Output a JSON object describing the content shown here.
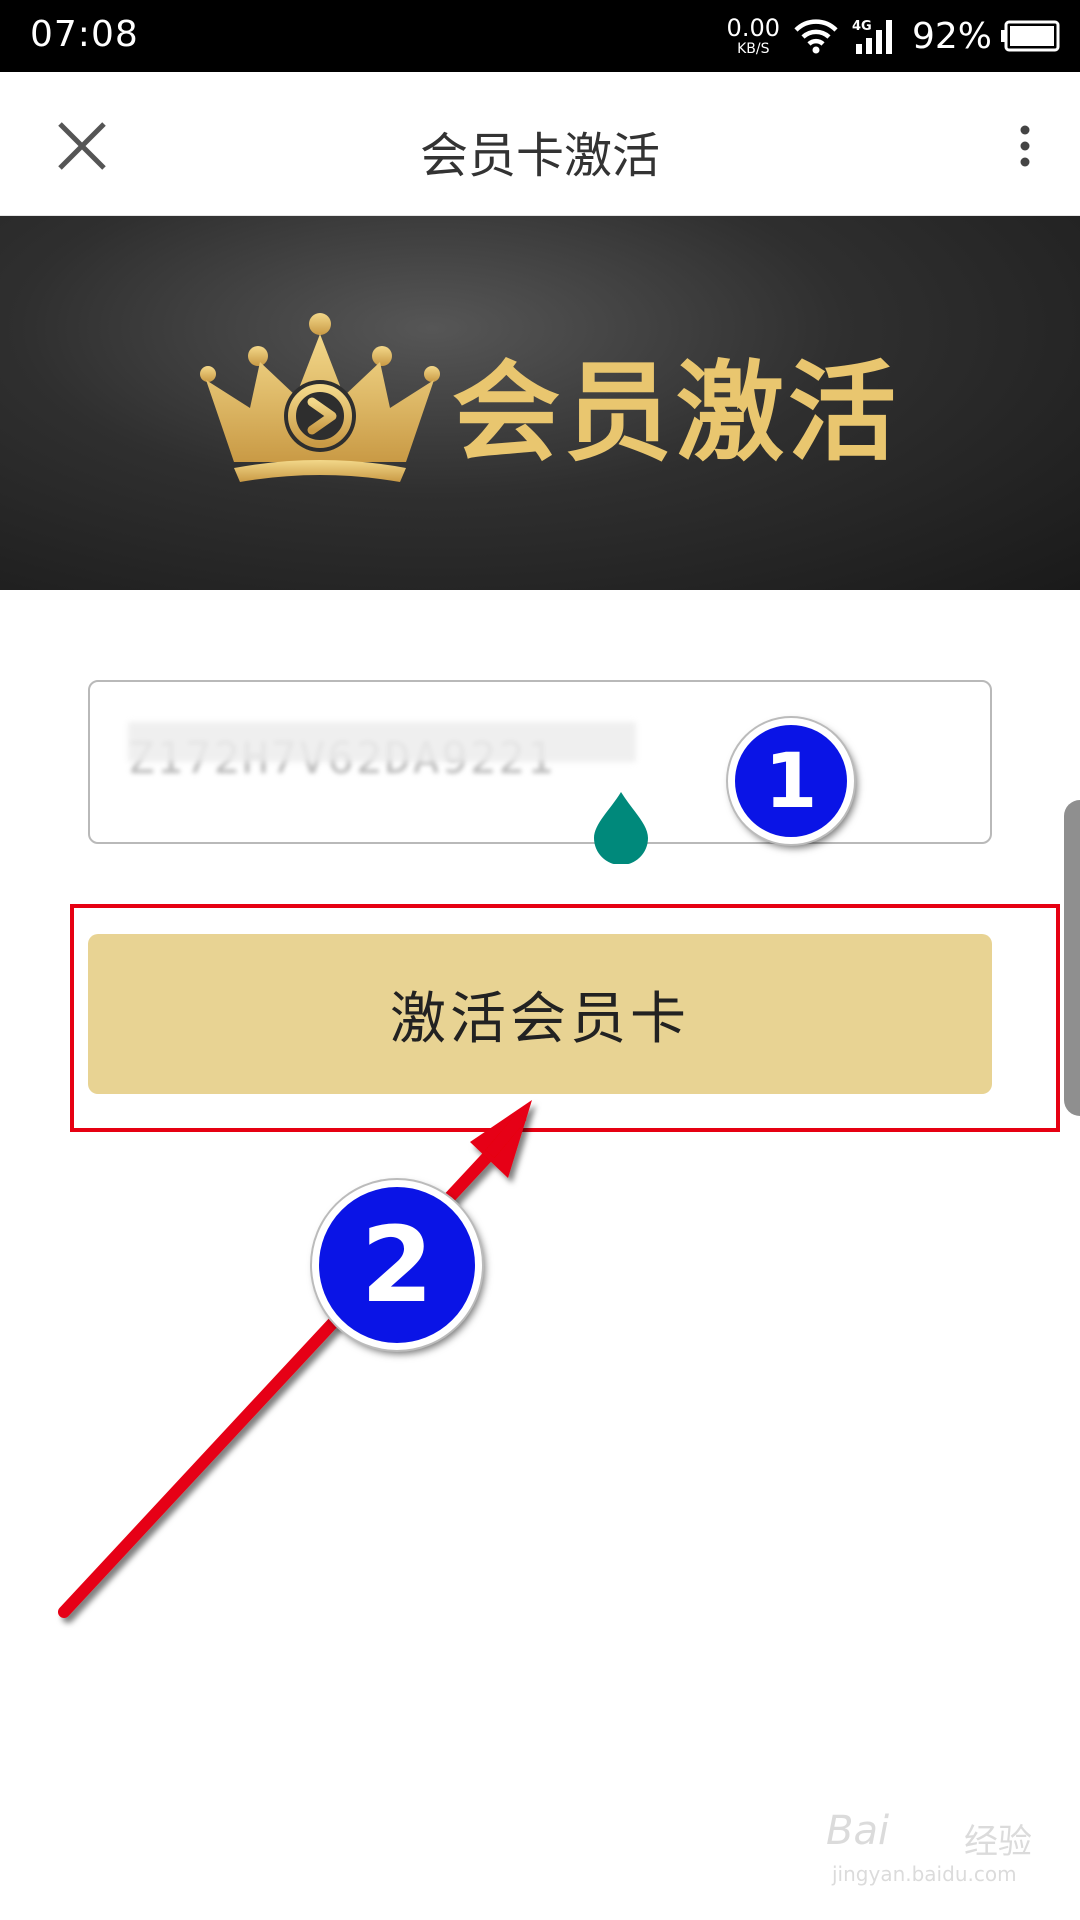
{
  "status_bar": {
    "time": "07:08",
    "net_speed_value": "0.00",
    "net_speed_unit": "KB/S",
    "network_type": "4G",
    "battery_percent": "92%"
  },
  "header": {
    "title": "会员卡激活",
    "close_icon": "close-icon",
    "more_icon": "more-vertical-icon"
  },
  "banner": {
    "title": "会员激活",
    "icon": "crown-play-icon",
    "accent_color": "#e9c66f"
  },
  "activation_form": {
    "code_value": "Z172H7V62DA9221",
    "button_label": "激活会员卡",
    "button_color": "#e8d393"
  },
  "annotations": {
    "step_1_label": "1",
    "step_2_label": "2",
    "highlight_color": "#e60012",
    "marker_color": "#0a14e6"
  },
  "watermark": {
    "brand": "Bai",
    "brand_suffix": "经验",
    "url": "jingyan.baidu.com"
  }
}
